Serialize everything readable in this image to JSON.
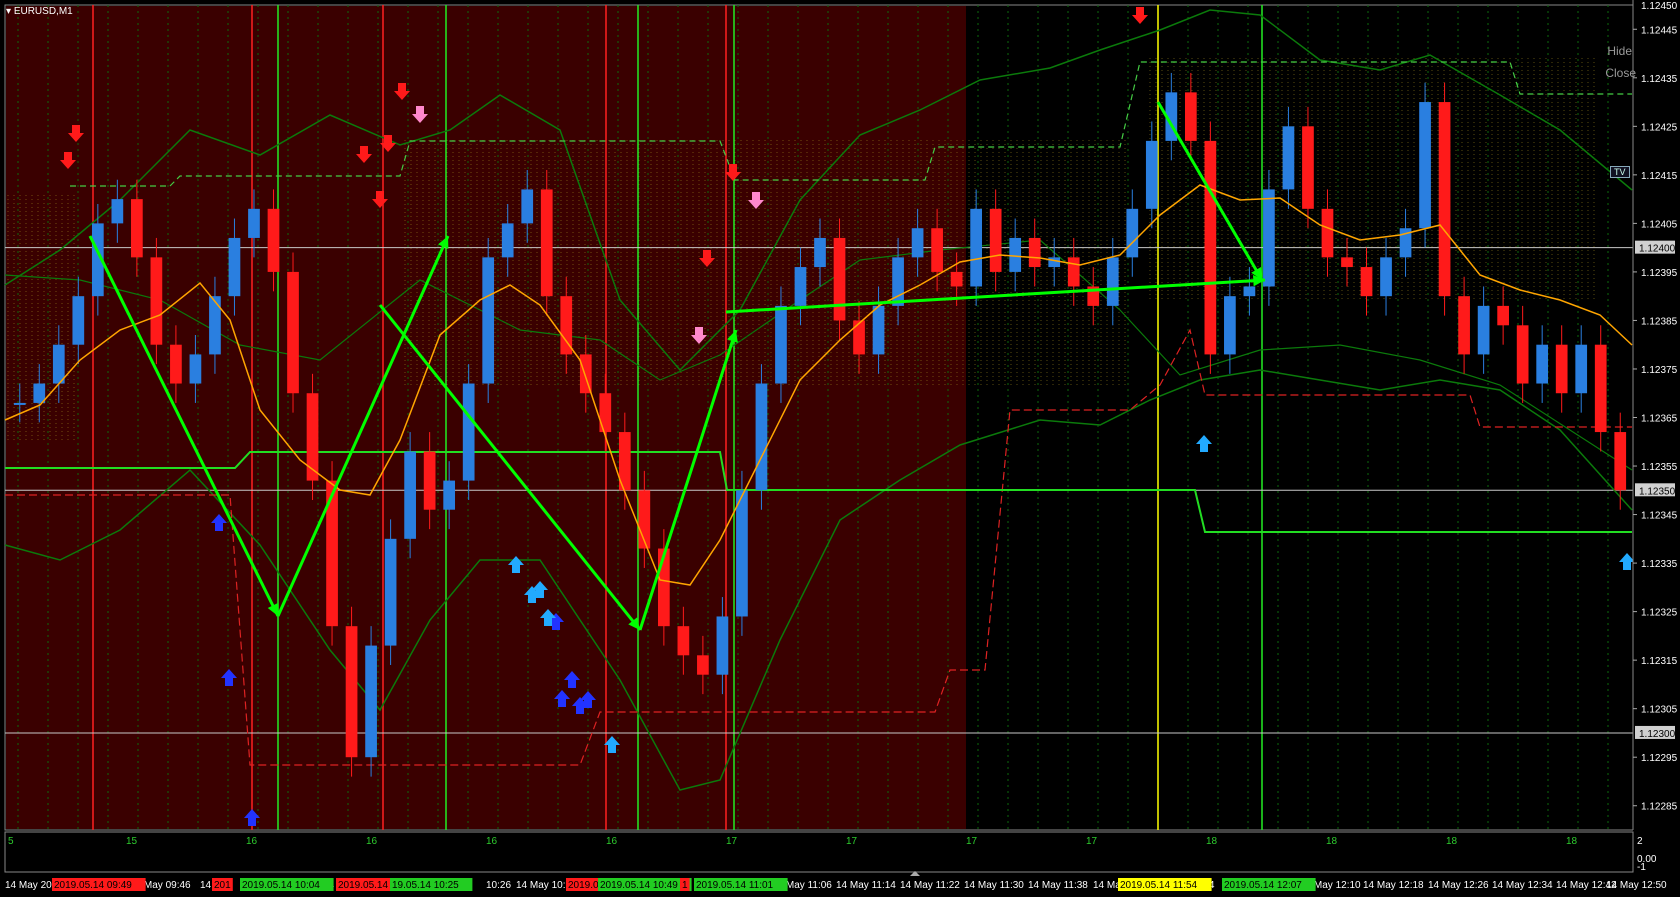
{
  "window": {
    "symbol_title": "EURUSD,M1",
    "hide_label": "Hide",
    "close_label": "Close",
    "tv_badge": "TV"
  },
  "colors": {
    "background": "#000000",
    "session_fill": "#3a0000",
    "bull_candle": "#2a7fe0",
    "bear_candle": "#ff1a1a",
    "ma_line": "#ffa500",
    "bands": "#0b7a0b",
    "zigzag": "#00ff00",
    "level_line": "#22dd22",
    "grid_dotted": "#0d6a0d"
  },
  "price_axis": {
    "labels": [
      "1.12445",
      "1.12435",
      "1.12425",
      "1.12415",
      "1.12405",
      "1.12395",
      "1.12385",
      "1.12375",
      "1.12365",
      "1.12355",
      "1.12345",
      "1.12335",
      "1.12325",
      "1.12315",
      "1.12305",
      "1.12295",
      "1.12285"
    ],
    "top_label": "1.12450",
    "highlighted": [
      "1.12400",
      "1.12350",
      "1.12300"
    ],
    "range": [
      1.1228,
      1.1245
    ]
  },
  "indicator_strip": {
    "labels": [
      "5",
      "15",
      "16",
      "16",
      "16",
      "16",
      "17",
      "17",
      "17",
      "17",
      "18",
      "18",
      "18",
      "18"
    ],
    "axis_right": [
      "2",
      "0.00",
      "-1"
    ]
  },
  "time_axis": {
    "labels": [
      "14 May 201",
      "14 May 09:46",
      "14 M",
      "14 M",
      "10:26",
      "14 May 10:",
      "14 May 11:06",
      "14 May 11:14",
      "14 May 11:22",
      "14 May 11:30",
      "14 May 11:38",
      "14 Ma",
      "1:54",
      "14 May 12:10",
      "14 May 12:18",
      "14 May 12:26",
      "14 May 12:34",
      "14 May 12:42",
      "14 May 12:50"
    ],
    "highlights": [
      {
        "text": "2019.05.14 09:49",
        "color": "#ff1a1a"
      },
      {
        "text": "201",
        "color": "#ff1a1a"
      },
      {
        "text": "2019.05.14 10:04",
        "color": "#22cc22"
      },
      {
        "text": "2019.05.14 10:17",
        "color": "#ff1a1a"
      },
      {
        "text": "19.05.14 10:25",
        "color": "#22cc22"
      },
      {
        "text": "2019.0",
        "color": "#ff1a1a"
      },
      {
        "text": "2019.05.14 10:49",
        "color": "#22cc22"
      },
      {
        "text": "1",
        "color": "#ff1a1a"
      },
      {
        "text": "2019.05.14 11:01",
        "color": "#22cc22"
      },
      {
        "text": "2019.05.14 11:54",
        "color": "#ffff00"
      },
      {
        "text": "2019.05.14 12:07",
        "color": "#22cc22"
      }
    ]
  },
  "chart_data": {
    "type": "candlestick",
    "symbol": "EURUSD",
    "timeframe": "M1",
    "ylim": [
      1.1228,
      1.1245
    ],
    "candles_close": [
      1.12368,
      1.12372,
      1.1238,
      1.1239,
      1.12405,
      1.1241,
      1.12398,
      1.1238,
      1.12372,
      1.12378,
      1.1239,
      1.12402,
      1.12408,
      1.12395,
      1.1237,
      1.12352,
      1.12322,
      1.12295,
      1.12318,
      1.1234,
      1.12358,
      1.12346,
      1.12352,
      1.12372,
      1.12398,
      1.12405,
      1.12412,
      1.1239,
      1.12378,
      1.1237,
      1.12362,
      1.1235,
      1.12338,
      1.12322,
      1.12316,
      1.12312,
      1.12324,
      1.1235,
      1.12372,
      1.12388,
      1.12396,
      1.12402,
      1.12385,
      1.12378,
      1.12388,
      1.12398,
      1.12404,
      1.12395,
      1.12392,
      1.12408,
      1.12395,
      1.12402,
      1.12396,
      1.12398,
      1.12392,
      1.12388,
      1.12398,
      1.12408,
      1.12422,
      1.12432,
      1.12422,
      1.12378,
      1.1239,
      1.12392,
      1.12412,
      1.12425,
      1.12408,
      1.12398,
      1.12396,
      1.1239,
      1.12398,
      1.12404,
      1.1243,
      1.1239,
      1.12378,
      1.12388,
      1.12384,
      1.12372,
      1.1238,
      1.1237,
      1.1238,
      1.12362,
      1.1235
    ],
    "zigzag_prices": [
      1.12402,
      1.1232,
      1.12402,
      1.1239,
      1.12322,
      1.12386,
      1.12394,
      1.1243,
      1.12396
    ],
    "support_levels": [
      1.1235,
      1.1234
    ],
    "arrows_down_count": 12,
    "arrows_up_count": 14
  }
}
